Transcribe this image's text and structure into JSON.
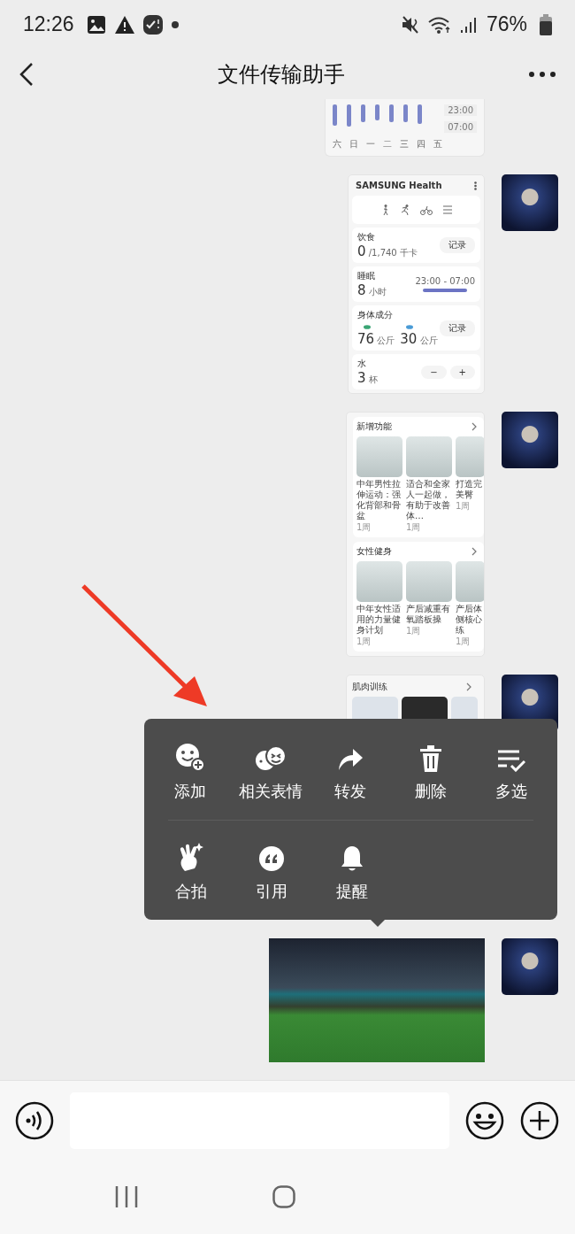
{
  "status_bar": {
    "time": "12:26",
    "battery": "76%"
  },
  "header": {
    "title": "文件传输助手"
  },
  "messages": [
    {
      "kind": "sleep_chart",
      "weekdays": [
        "六",
        "日",
        "一",
        "二",
        "三",
        "四",
        "五"
      ],
      "times": [
        "23:00",
        "07:00"
      ]
    },
    {
      "kind": "health_card",
      "app_title": "SAMSUNG Health",
      "food": {
        "label": "饮食",
        "value": "0",
        "target": "/1,740 千卡",
        "button": "记录"
      },
      "sleep": {
        "label": "睡眠",
        "value": "8",
        "unit": "小时",
        "range": "23:00 - 07:00"
      },
      "body": {
        "label": "身体成分",
        "values": [
          {
            "value": "76",
            "unit": "公斤"
          },
          {
            "value": "30",
            "unit": "公斤"
          }
        ],
        "button": "记录"
      },
      "water": {
        "label": "水",
        "value": "3",
        "unit": "杯",
        "minus": "−",
        "plus": "+"
      }
    },
    {
      "kind": "programs_card",
      "sections": [
        {
          "title": "新增功能",
          "items": [
            {
              "caption": "中年男性拉伸运动：强化背部和骨盆",
              "count": "1周"
            },
            {
              "caption": "适合和全家人一起做，有助于改善体…",
              "count": "1周"
            },
            {
              "caption": "打造完美臀",
              "count": "1周"
            }
          ]
        },
        {
          "title": "女性健身",
          "items": [
            {
              "caption": "中年女性适用的力量健身计划",
              "count": "1周"
            },
            {
              "caption": "产后减重有氧踏板操",
              "count": "1周"
            },
            {
              "caption": "产后体侧核心练",
              "count": "1周"
            }
          ]
        }
      ]
    },
    {
      "kind": "program_peek",
      "title": "肌肉训练"
    },
    {
      "kind": "photo"
    }
  ],
  "context_menu": {
    "rows": [
      [
        {
          "kind": "emoji_add",
          "label": "添加"
        },
        {
          "kind": "sticker",
          "label": "相关表情"
        },
        {
          "kind": "forward",
          "label": "转发"
        },
        {
          "kind": "delete",
          "label": "删除"
        },
        {
          "kind": "multiselect",
          "label": "多选"
        }
      ],
      [
        {
          "kind": "pat",
          "label": "合拍"
        },
        {
          "kind": "quote",
          "label": "引用"
        },
        {
          "kind": "remind",
          "label": "提醒"
        }
      ]
    ]
  }
}
